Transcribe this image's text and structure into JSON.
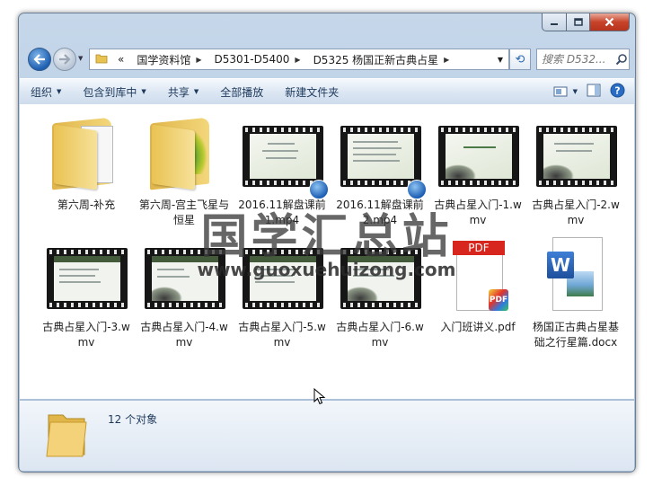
{
  "window": {
    "caption_icons": [
      "minimize-icon",
      "maximize-icon",
      "close-icon"
    ]
  },
  "address": {
    "overflow": "«",
    "segments": [
      "国学资料馆",
      "D5301-D5400",
      "D5325 杨国正新古典占星"
    ]
  },
  "search": {
    "placeholder": "搜索 D532..."
  },
  "toolbar": {
    "organize": "组织",
    "include_in_library": "包含到库中",
    "share": "共享",
    "play_all": "全部播放",
    "new_folder": "新建文件夹"
  },
  "items": [
    {
      "name": "第六周-补充",
      "kind": "folder"
    },
    {
      "name": "第六周-宫主飞星与恒星",
      "kind": "folder"
    },
    {
      "name": "2016.11解盘课前1.mp4",
      "kind": "video"
    },
    {
      "name": "2016.11解盘课前2.mp4",
      "kind": "video"
    },
    {
      "name": "古典占星入门-1.wmv",
      "kind": "video"
    },
    {
      "name": "古典占星入门-2.wmv",
      "kind": "video"
    },
    {
      "name": "古典占星入门-3.wmv",
      "kind": "video"
    },
    {
      "name": "古典占星入门-4.wmv",
      "kind": "video"
    },
    {
      "name": "古典占星入门-5.wmv",
      "kind": "video"
    },
    {
      "name": "古典占星入门-6.wmv",
      "kind": "video"
    },
    {
      "name": "入门班讲义.pdf",
      "kind": "pdf",
      "badge_text": "PDF"
    },
    {
      "name": "杨国正古典占星基础之行星篇.docx",
      "kind": "docx",
      "badge_text": "W"
    }
  ],
  "watermark": {
    "title": "国学汇总站",
    "url": "www.guoxuehuizong.com"
  },
  "status": {
    "count_text": "12 个对象"
  },
  "colors": {
    "accent": "#1e395b",
    "pdf_red": "#d7261d",
    "folder": "#e9c352"
  }
}
